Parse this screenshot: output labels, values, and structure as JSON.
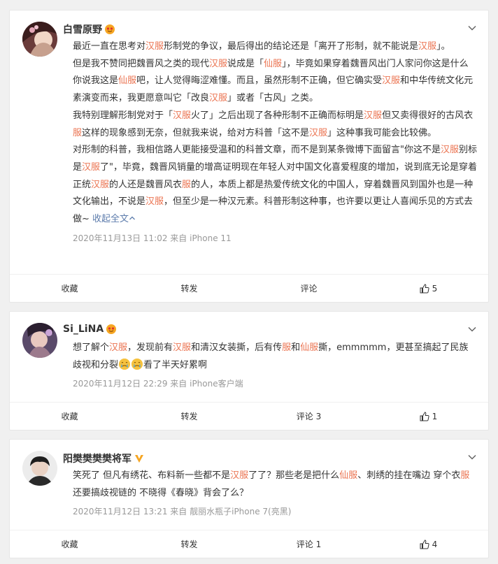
{
  "posts": [
    {
      "user": "白雪原野",
      "content_segments": [
        [
          {
            "t": "最近一直在思考对",
            "k": false
          },
          {
            "t": "汉服",
            "k": true
          },
          {
            "t": "形制党的争议，最后得出的结论还是「离开了形制，就不能说是",
            "k": false
          },
          {
            "t": "汉服",
            "k": true
          },
          {
            "t": "」。",
            "k": false
          }
        ],
        [
          {
            "t": "但是我不赞同把魏晋风之类的现代",
            "k": false
          },
          {
            "t": "汉服",
            "k": true
          },
          {
            "t": "说成是「",
            "k": false
          },
          {
            "t": "仙服",
            "k": true
          },
          {
            "t": "」，毕竟如果穿着魏晋风出门人家问你这是什么你说我这是",
            "k": false
          },
          {
            "t": "仙服",
            "k": true
          },
          {
            "t": "吧，让人觉得晦涩难懂。而且，虽然形制不正确，但它确实受",
            "k": false
          },
          {
            "t": "汉服",
            "k": true
          },
          {
            "t": "和中华传统文化元素演变而来，我更愿意叫它「改良",
            "k": false
          },
          {
            "t": "汉服",
            "k": true
          },
          {
            "t": "」或者「古风」之类。",
            "k": false
          }
        ],
        [
          {
            "t": "我特别理解形制党对于「",
            "k": false
          },
          {
            "t": "汉服",
            "k": true
          },
          {
            "t": "火了」之后出现了各种形制不正确而标明是",
            "k": false
          },
          {
            "t": "汉服",
            "k": true
          },
          {
            "t": "但又卖得很好的古风衣",
            "k": false
          },
          {
            "t": "服",
            "k": true
          },
          {
            "t": "这样的现象感到无奈，但就我来说，给对方科普「这不是",
            "k": false
          },
          {
            "t": "汉服",
            "k": true
          },
          {
            "t": "」这种事我可能会比较佛。",
            "k": false
          }
        ],
        [
          {
            "t": "对形制的科普，我相信路人更能接受温和的科普文章，而不是到某条微博下面留言\"你这不是",
            "k": false
          },
          {
            "t": "汉服",
            "k": true
          },
          {
            "t": "别标是",
            "k": false
          },
          {
            "t": "汉服",
            "k": true
          },
          {
            "t": "了\"，毕竟，魏晋风销量的增高证明现在年轻人对中国文化喜爱程度的增加，说到底无论是穿着正统",
            "k": false
          },
          {
            "t": "汉服",
            "k": true
          },
          {
            "t": "的人还是魏晋风衣",
            "k": false
          },
          {
            "t": "服",
            "k": true
          },
          {
            "t": "的人，本质上都是热爱传统文化的中国人，穿着魏晋风到国外也是一种文化输出，不说是",
            "k": false
          },
          {
            "t": "汉服",
            "k": true
          },
          {
            "t": "，但至少是一种汉元素。科普形制这种事，也许要以更让人喜闻乐见的方式去做~ ",
            "k": false
          }
        ]
      ],
      "collapse_text": "收起全文",
      "meta": "2020年11月13日 11:02  来自 iPhone 11",
      "actions": {
        "favorite": "收藏",
        "repost": "转发",
        "comment": "评论",
        "like": "5"
      }
    },
    {
      "user": "Si_LiNA",
      "content_segments": [
        [
          {
            "t": "想了解个",
            "k": false
          },
          {
            "t": "汉服",
            "k": true
          },
          {
            "t": "，发现前有",
            "k": false
          },
          {
            "t": "汉服",
            "k": true
          },
          {
            "t": "和清汉女装撕，后有传",
            "k": false
          },
          {
            "t": "服",
            "k": true
          },
          {
            "t": "和",
            "k": false
          },
          {
            "t": "仙服",
            "k": true
          },
          {
            "t": "撕，emmmmm，更甚至搞起了民族歧视和分裂",
            "k": false
          },
          {
            "t": "EMOJI",
            "k": false
          },
          {
            "t": "看了半天好累啊",
            "k": false
          }
        ]
      ],
      "meta": "2020年11月12日 22:29  来自 iPhone客户端",
      "actions": {
        "favorite": "收藏",
        "repost": "转发",
        "comment": "评论 3",
        "like": "1"
      }
    },
    {
      "user": "阳樊樊樊樊将军",
      "content_segments": [
        [
          {
            "t": "笑死了 但凡有绣花、布料新一些都不是",
            "k": false
          },
          {
            "t": "汉服",
            "k": true
          },
          {
            "t": "了了？那些老是把什么",
            "k": false
          },
          {
            "t": "仙服",
            "k": true
          },
          {
            "t": "、刺绣的挂在嘴边 穿个衣",
            "k": false
          },
          {
            "t": "服",
            "k": true
          },
          {
            "t": "还要搞歧视链的 不晓得《春晓》背会了么？",
            "k": false
          }
        ]
      ],
      "meta": "2020年11月12日 13:21  来自 靓丽水瓶子iPhone 7(亮黑)",
      "actions": {
        "favorite": "收藏",
        "repost": "转发",
        "comment": "评论 1",
        "like": "4"
      }
    }
  ],
  "colors": {
    "keyword": "#eb7350",
    "link": "#5d7cac",
    "meta": "#999999",
    "vip": "#f6a623"
  }
}
